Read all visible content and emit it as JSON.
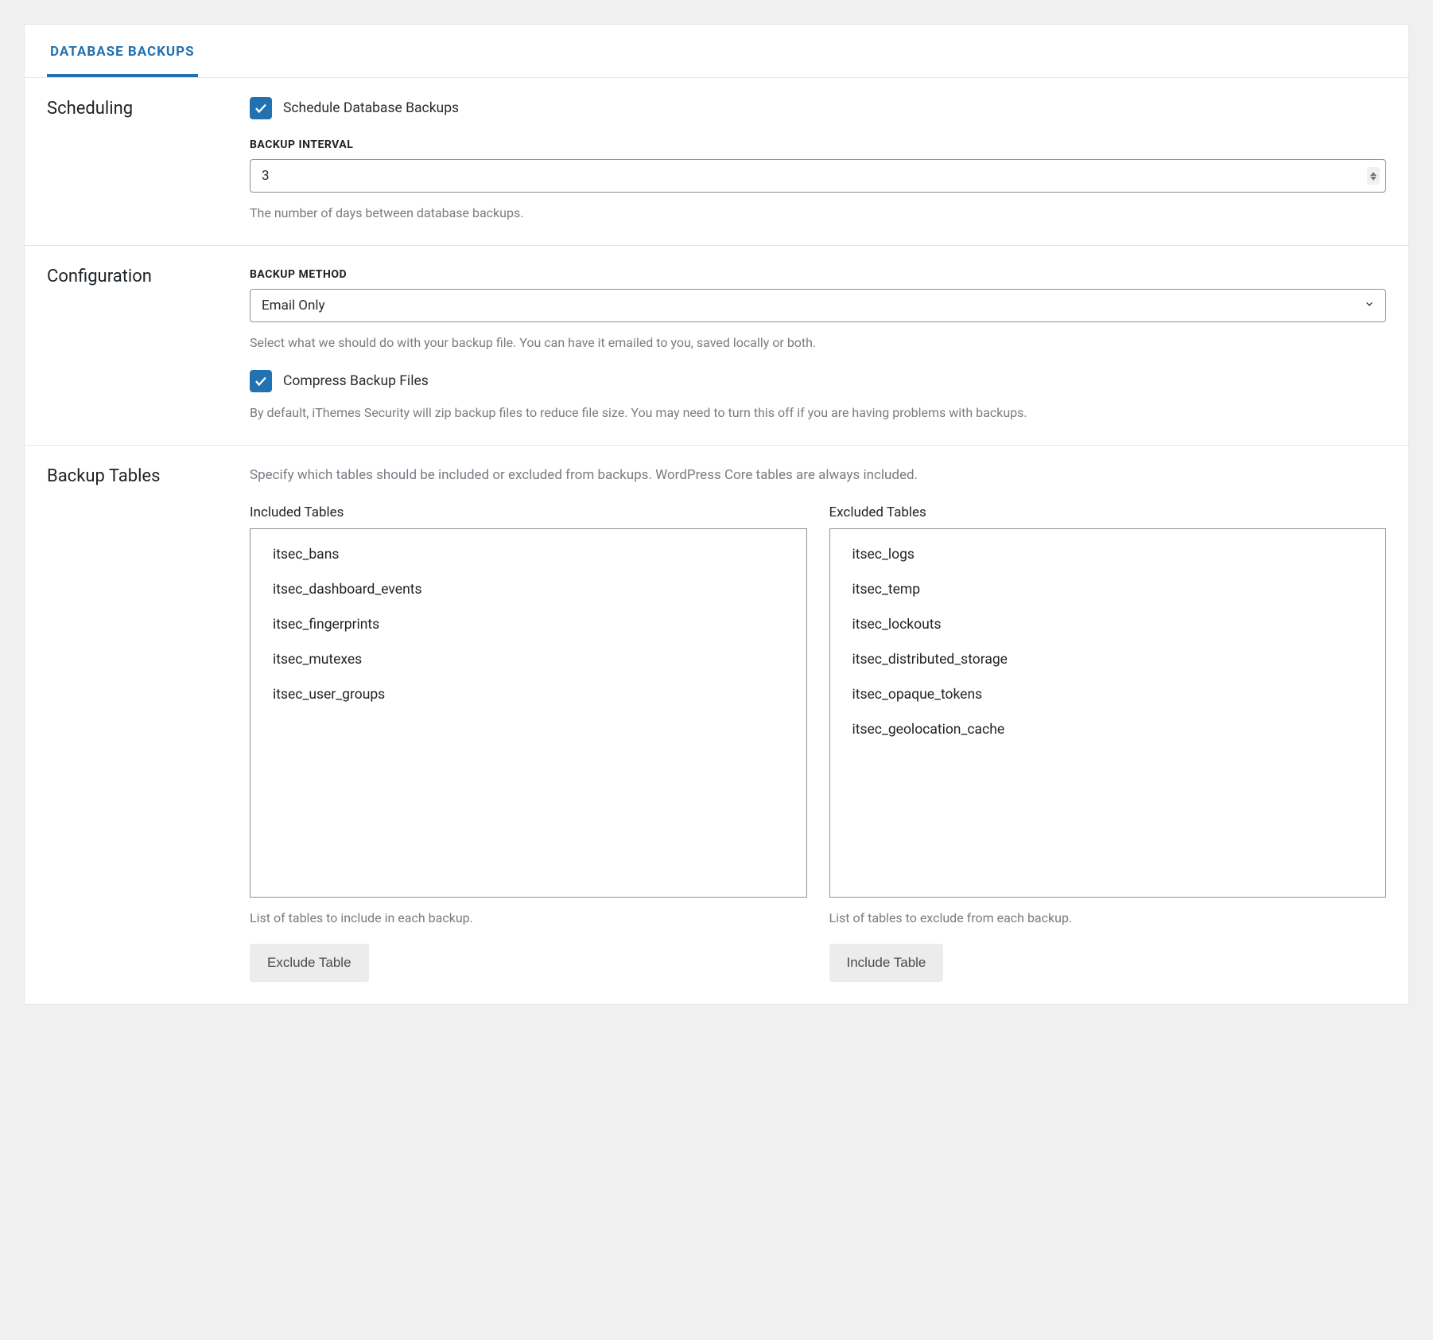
{
  "tab": {
    "label": "DATABASE BACKUPS"
  },
  "scheduling": {
    "title": "Scheduling",
    "checkbox_label": "Schedule Database Backups",
    "interval_label": "BACKUP INTERVAL",
    "interval_value": "3",
    "interval_help": "The number of days between database backups."
  },
  "configuration": {
    "title": "Configuration",
    "method_label": "BACKUP METHOD",
    "method_value": "Email Only",
    "method_help": "Select what we should do with your backup file. You can have it emailed to you, saved locally or both.",
    "compress_label": "Compress Backup Files",
    "compress_help": "By default, iThemes Security will zip backup files to reduce file size. You may need to turn this off if you are having problems with backups."
  },
  "backup_tables": {
    "title": "Backup Tables",
    "intro": "Specify which tables should be included or excluded from backups. WordPress Core tables are always included.",
    "included": {
      "title": "Included Tables",
      "items": [
        "itsec_bans",
        "itsec_dashboard_events",
        "itsec_fingerprints",
        "itsec_mutexes",
        "itsec_user_groups"
      ],
      "help": "List of tables to include in each backup.",
      "button": "Exclude Table"
    },
    "excluded": {
      "title": "Excluded Tables",
      "items": [
        "itsec_logs",
        "itsec_temp",
        "itsec_lockouts",
        "itsec_distributed_storage",
        "itsec_opaque_tokens",
        "itsec_geolocation_cache"
      ],
      "help": "List of tables to exclude from each backup.",
      "button": "Include Table"
    }
  }
}
